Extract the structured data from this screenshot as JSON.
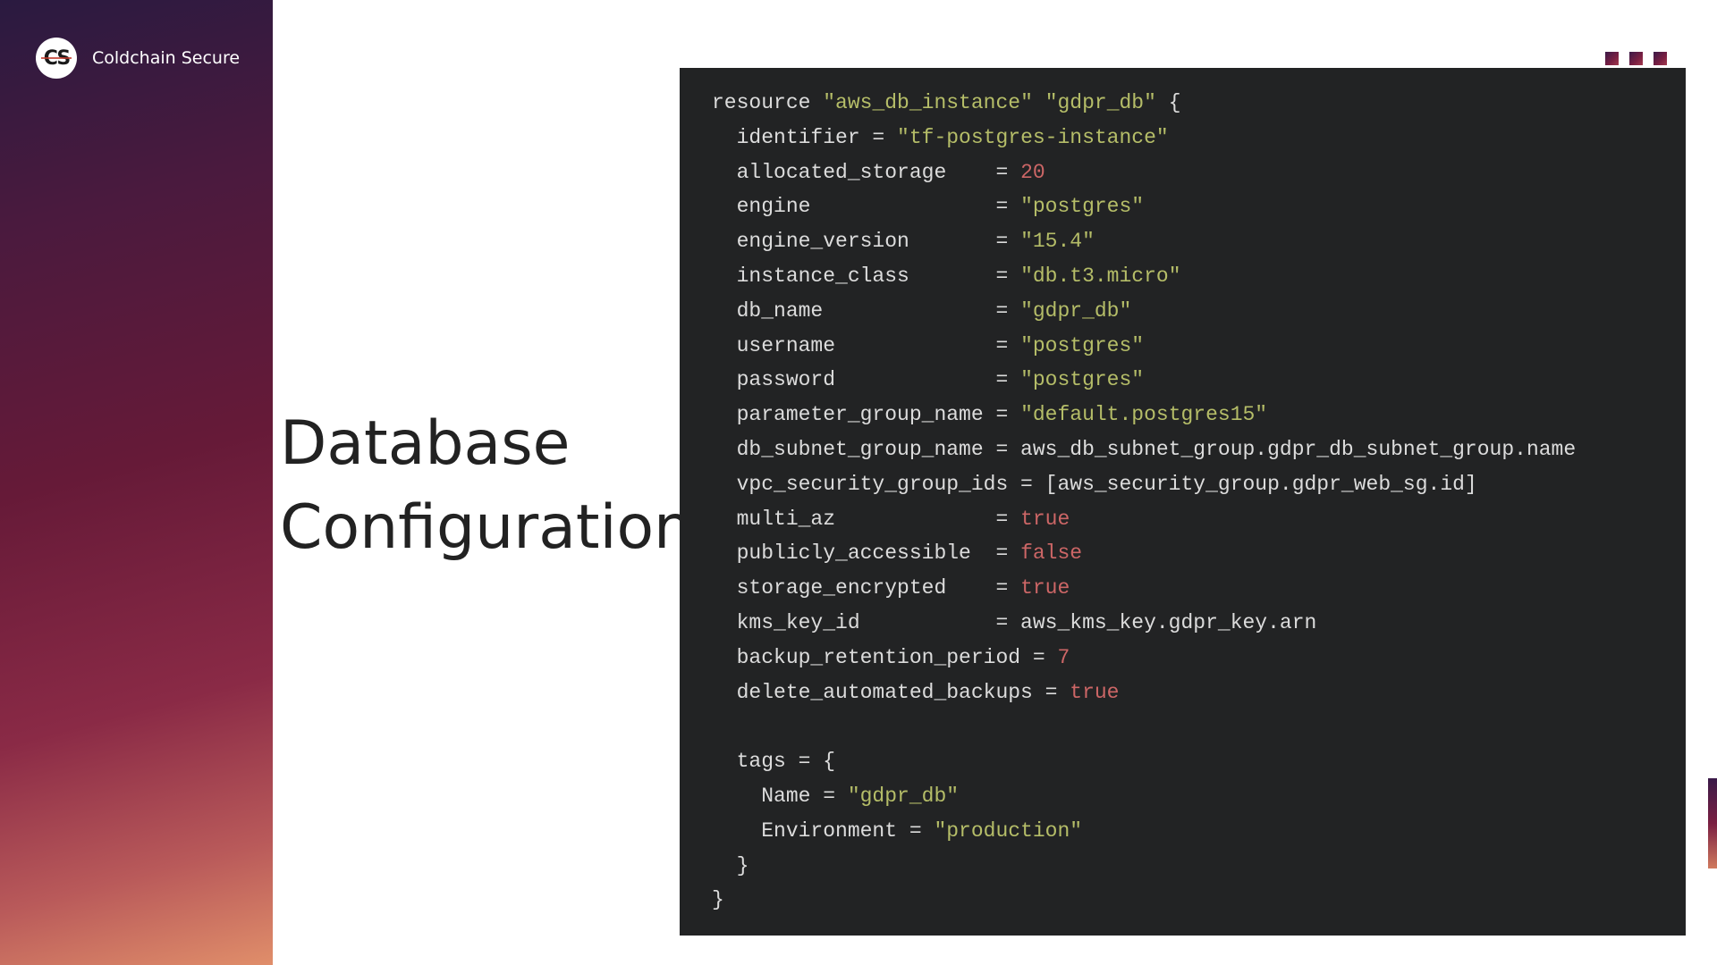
{
  "brand": {
    "logo_text": "CS",
    "name": "Coldchain Secure"
  },
  "slide_title": {
    "line1": "Database",
    "line2": "Configuration"
  },
  "code": {
    "language": "terraform",
    "lines": [
      [
        {
          "t": "resource ",
          "k": "pl"
        },
        {
          "t": "\"aws_db_instance\"",
          "k": "str"
        },
        {
          "t": " ",
          "k": "pl"
        },
        {
          "t": "\"gdpr_db\"",
          "k": "str"
        },
        {
          "t": " {",
          "k": "pl"
        }
      ],
      [
        {
          "t": "  identifier = ",
          "k": "pl"
        },
        {
          "t": "\"tf-postgres-instance\"",
          "k": "str"
        }
      ],
      [
        {
          "t": "  allocated_storage    = ",
          "k": "pl"
        },
        {
          "t": "20",
          "k": "num"
        }
      ],
      [
        {
          "t": "  engine               = ",
          "k": "pl"
        },
        {
          "t": "\"postgres\"",
          "k": "str"
        }
      ],
      [
        {
          "t": "  engine_version       = ",
          "k": "pl"
        },
        {
          "t": "\"15.4\"",
          "k": "str"
        }
      ],
      [
        {
          "t": "  instance_class       = ",
          "k": "pl"
        },
        {
          "t": "\"db.t3.micro\"",
          "k": "str"
        }
      ],
      [
        {
          "t": "  db_name              = ",
          "k": "pl"
        },
        {
          "t": "\"gdpr_db\"",
          "k": "str"
        }
      ],
      [
        {
          "t": "  username             = ",
          "k": "pl"
        },
        {
          "t": "\"postgres\"",
          "k": "str"
        }
      ],
      [
        {
          "t": "  password             = ",
          "k": "pl"
        },
        {
          "t": "\"postgres\"",
          "k": "str"
        }
      ],
      [
        {
          "t": "  parameter_group_name = ",
          "k": "pl"
        },
        {
          "t": "\"default.postgres15\"",
          "k": "str"
        }
      ],
      [
        {
          "t": "  db_subnet_group_name = aws_db_subnet_group.gdpr_db_subnet_group.name",
          "k": "pl"
        }
      ],
      [
        {
          "t": "  vpc_security_group_ids = [aws_security_group.gdpr_web_sg.id]",
          "k": "pl"
        }
      ],
      [
        {
          "t": "  multi_az             = ",
          "k": "pl"
        },
        {
          "t": "true",
          "k": "kw"
        }
      ],
      [
        {
          "t": "  publicly_accessible  = ",
          "k": "pl"
        },
        {
          "t": "false",
          "k": "kw"
        }
      ],
      [
        {
          "t": "  storage_encrypted    = ",
          "k": "pl"
        },
        {
          "t": "true",
          "k": "kw"
        }
      ],
      [
        {
          "t": "  kms_key_id           = aws_kms_key.gdpr_key.arn",
          "k": "pl"
        }
      ],
      [
        {
          "t": "  backup_retention_period = ",
          "k": "pl"
        },
        {
          "t": "7",
          "k": "num"
        }
      ],
      [
        {
          "t": "  delete_automated_backups = ",
          "k": "pl"
        },
        {
          "t": "true",
          "k": "kw"
        }
      ],
      [
        {
          "t": "",
          "k": "pl"
        }
      ],
      [
        {
          "t": "  tags = {",
          "k": "pl"
        }
      ],
      [
        {
          "t": "    Name = ",
          "k": "pl"
        },
        {
          "t": "\"gdpr_db\"",
          "k": "str"
        }
      ],
      [
        {
          "t": "    Environment = ",
          "k": "pl"
        },
        {
          "t": "\"production\"",
          "k": "str"
        }
      ],
      [
        {
          "t": "  }",
          "k": "pl"
        }
      ],
      [
        {
          "t": "}",
          "k": "pl"
        }
      ]
    ]
  },
  "colors": {
    "code_background": "#222324",
    "code_plain": "#dcdcdc",
    "code_string": "#b5bd68",
    "code_number_keyword": "#cc6666",
    "title_text": "#222222",
    "sidebar_gradient_top": "#2a1a40",
    "sidebar_gradient_bottom": "#e08e6a"
  }
}
